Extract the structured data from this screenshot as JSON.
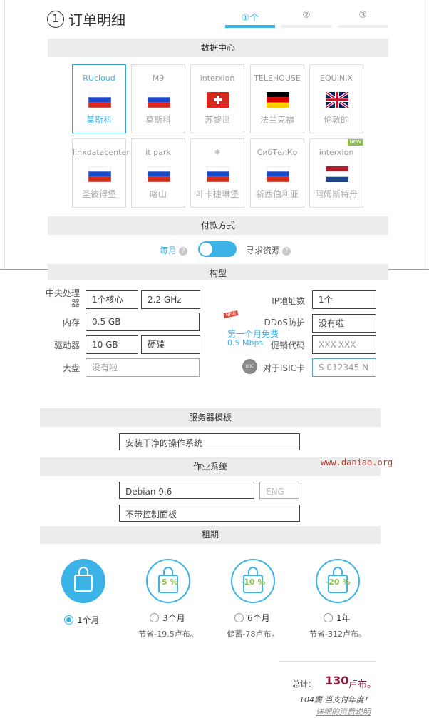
{
  "title": {
    "num": "1",
    "text": "订单明细"
  },
  "steps": [
    "①个",
    "②",
    "③"
  ],
  "sections": {
    "datacenter": "数据中心",
    "payment": "付款方式",
    "config": "构型",
    "template": "服务器模板",
    "os": "作业系统",
    "term": "租期"
  },
  "datacenters": [
    {
      "logo": "RUcloud",
      "name": "莫斯科",
      "flag": "ru",
      "selected": true
    },
    {
      "logo": "M9",
      "name": "莫斯科",
      "flag": "ru"
    },
    {
      "logo": "interxion",
      "name": "苏黎世",
      "flag": "ch"
    },
    {
      "logo": "TELEHOUSE",
      "name": "法兰克福",
      "flag": "de"
    },
    {
      "logo": "EQUINIX",
      "name": "伦敦的",
      "flag": "gb"
    },
    {
      "logo": "linxdatacenter",
      "name": "圣彼得堡",
      "flag": "ru"
    },
    {
      "logo": "it park",
      "name": "喀山",
      "flag": "ru"
    },
    {
      "logo": "❄",
      "name": "叶卡捷琳堡",
      "flag": "ru"
    },
    {
      "logo": "СибТелКо",
      "name": "新西伯利亚",
      "flag": "ru"
    },
    {
      "logo": "interxion",
      "name": "阿姆斯特丹",
      "flag": "nl",
      "badge": "NEW"
    }
  ],
  "payment": {
    "monthly": "每月",
    "request": "寻求资源",
    "qm": "?"
  },
  "config": {
    "cpu_label": "中央处理器",
    "cpu_cores": "1个核心",
    "cpu_freq": "2.2 GHz",
    "ram_label": "内存",
    "ram_value": "0.5 GB",
    "drive_label": "驱动器",
    "drive_size": "10 GB",
    "drive_type": "硬碟",
    "disk_label": "大盘",
    "disk_placeholder": "没有啦",
    "ip_label": "IP地址数",
    "ip_value": "1个",
    "ddos_label": "DDoS防护",
    "ddos_value": "没有啦",
    "promo_label": "促销代码",
    "promo_placeholder": "XXX-XXX-XXX",
    "isic_label": "对于ISIC卡",
    "isic_placeholder": "S 012345 N",
    "isic_badge": "ISIC",
    "free_badge": "NEW",
    "free_line1": "第一个月免费",
    "free_line2": "0.5 Mbps"
  },
  "template": {
    "value": "安装干净的操作系统"
  },
  "os": {
    "distro": "Debian 9.6",
    "lang": "ENG",
    "panel": "不带控制面板"
  },
  "watermark": "www.daniao.org",
  "terms": [
    {
      "label": "1个月",
      "save": "",
      "pct": "",
      "selected": true
    },
    {
      "label": "3个月",
      "save": "节省-19.5卢布。",
      "pct": "-5 %"
    },
    {
      "label": "6个月",
      "save": "储蓄-78卢布。",
      "pct": "-10 %"
    },
    {
      "label": "1年",
      "save": "节省-312卢布。",
      "pct": "-20 %"
    }
  ],
  "total": {
    "label": "总计：",
    "amount": "130",
    "unit": "卢布。",
    "note": "104腐 当支付年度！",
    "link": "详细的资费说明"
  },
  "colors": {
    "accent": "#3bb3e6",
    "price": "#8b1538",
    "green": "#8bc34a"
  }
}
